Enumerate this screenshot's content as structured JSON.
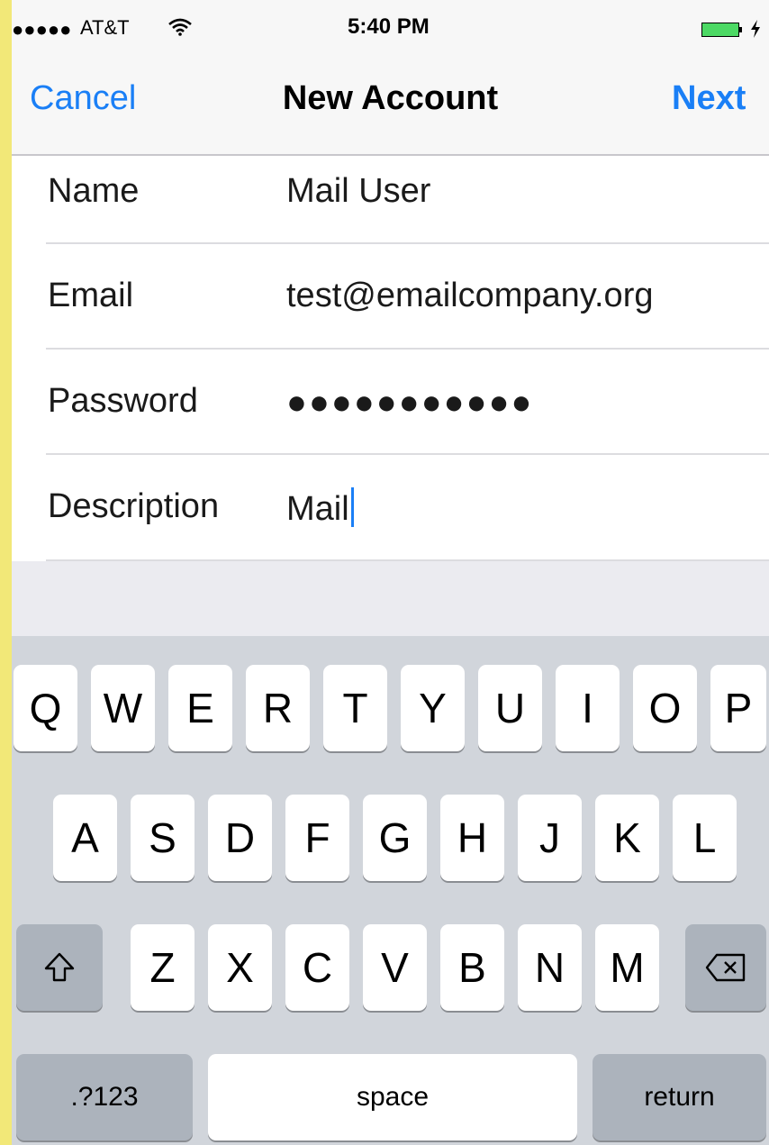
{
  "status_bar": {
    "signal": "●●●●●",
    "carrier": "AT&T",
    "wifi_icon": "wifi-icon",
    "time": "5:40 PM",
    "battery_icon": "battery-icon"
  },
  "nav": {
    "cancel_label": "Cancel",
    "title": "New Account",
    "next_label": "Next"
  },
  "form": {
    "rows": [
      {
        "label": "Name",
        "value": "Mail User"
      },
      {
        "label": "Email",
        "value": "test@emailcompany.org"
      },
      {
        "label": "Password",
        "value": "●●●●●●●●●●●"
      },
      {
        "label": "Description",
        "value": "Mail"
      }
    ]
  },
  "keyboard": {
    "row1": [
      "Q",
      "W",
      "E",
      "R",
      "T",
      "Y",
      "U",
      "I",
      "O",
      "P"
    ],
    "row2": [
      "A",
      "S",
      "D",
      "F",
      "G",
      "H",
      "J",
      "K",
      "L"
    ],
    "row3": [
      "Z",
      "X",
      "C",
      "V",
      "B",
      "N",
      "M"
    ],
    "shift_icon": "shift-icon",
    "delete_icon": "delete-icon",
    "numbers_label": ".?123",
    "space_label": "space",
    "return_label": "return"
  },
  "colors": {
    "accent": "#1a7ff6",
    "frame": "#f2e878",
    "keyboard_bg": "#d1d5db",
    "key_dark": "#acb3bc"
  }
}
